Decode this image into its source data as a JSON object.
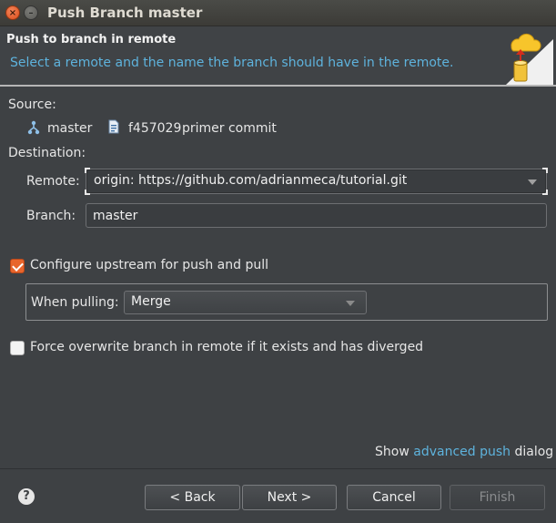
{
  "window": {
    "title": "Push Branch master",
    "close_glyph": "×",
    "minimize_glyph": "–"
  },
  "header": {
    "title": "Push to branch in remote",
    "description": "Select a remote and the name the branch should have in the remote.",
    "icon": "push-to-cloud-icon"
  },
  "source": {
    "label": "Source:",
    "branch_icon": "branch-icon",
    "branch": "master",
    "commit_icon": "commit-icon",
    "commit_id": "f457029",
    "commit_message": "primer commit"
  },
  "destination": {
    "label": "Destination:",
    "remote_label": "Remote:",
    "remote_value": "origin: https://github.com/adrianmeca/tutorial.git",
    "branch_label": "Branch:",
    "branch_value": "master"
  },
  "upstream": {
    "checked": true,
    "label": "Configure upstream for push and pull",
    "when_pulling_label": "When pulling:",
    "when_pulling_value": "Merge"
  },
  "force": {
    "checked": false,
    "label": "Force overwrite branch in remote if it exists and has diverged"
  },
  "advanced": {
    "prefix": "Show",
    "link": "advanced push",
    "suffix": "dialog"
  },
  "buttons": {
    "help": "?",
    "back": "< Back",
    "next": "Next >",
    "cancel": "Cancel",
    "finish": "Finish"
  },
  "colors": {
    "accent_link": "#5eb3dd",
    "checkbox_checked": "#e8652c",
    "background": "#3e4144"
  }
}
